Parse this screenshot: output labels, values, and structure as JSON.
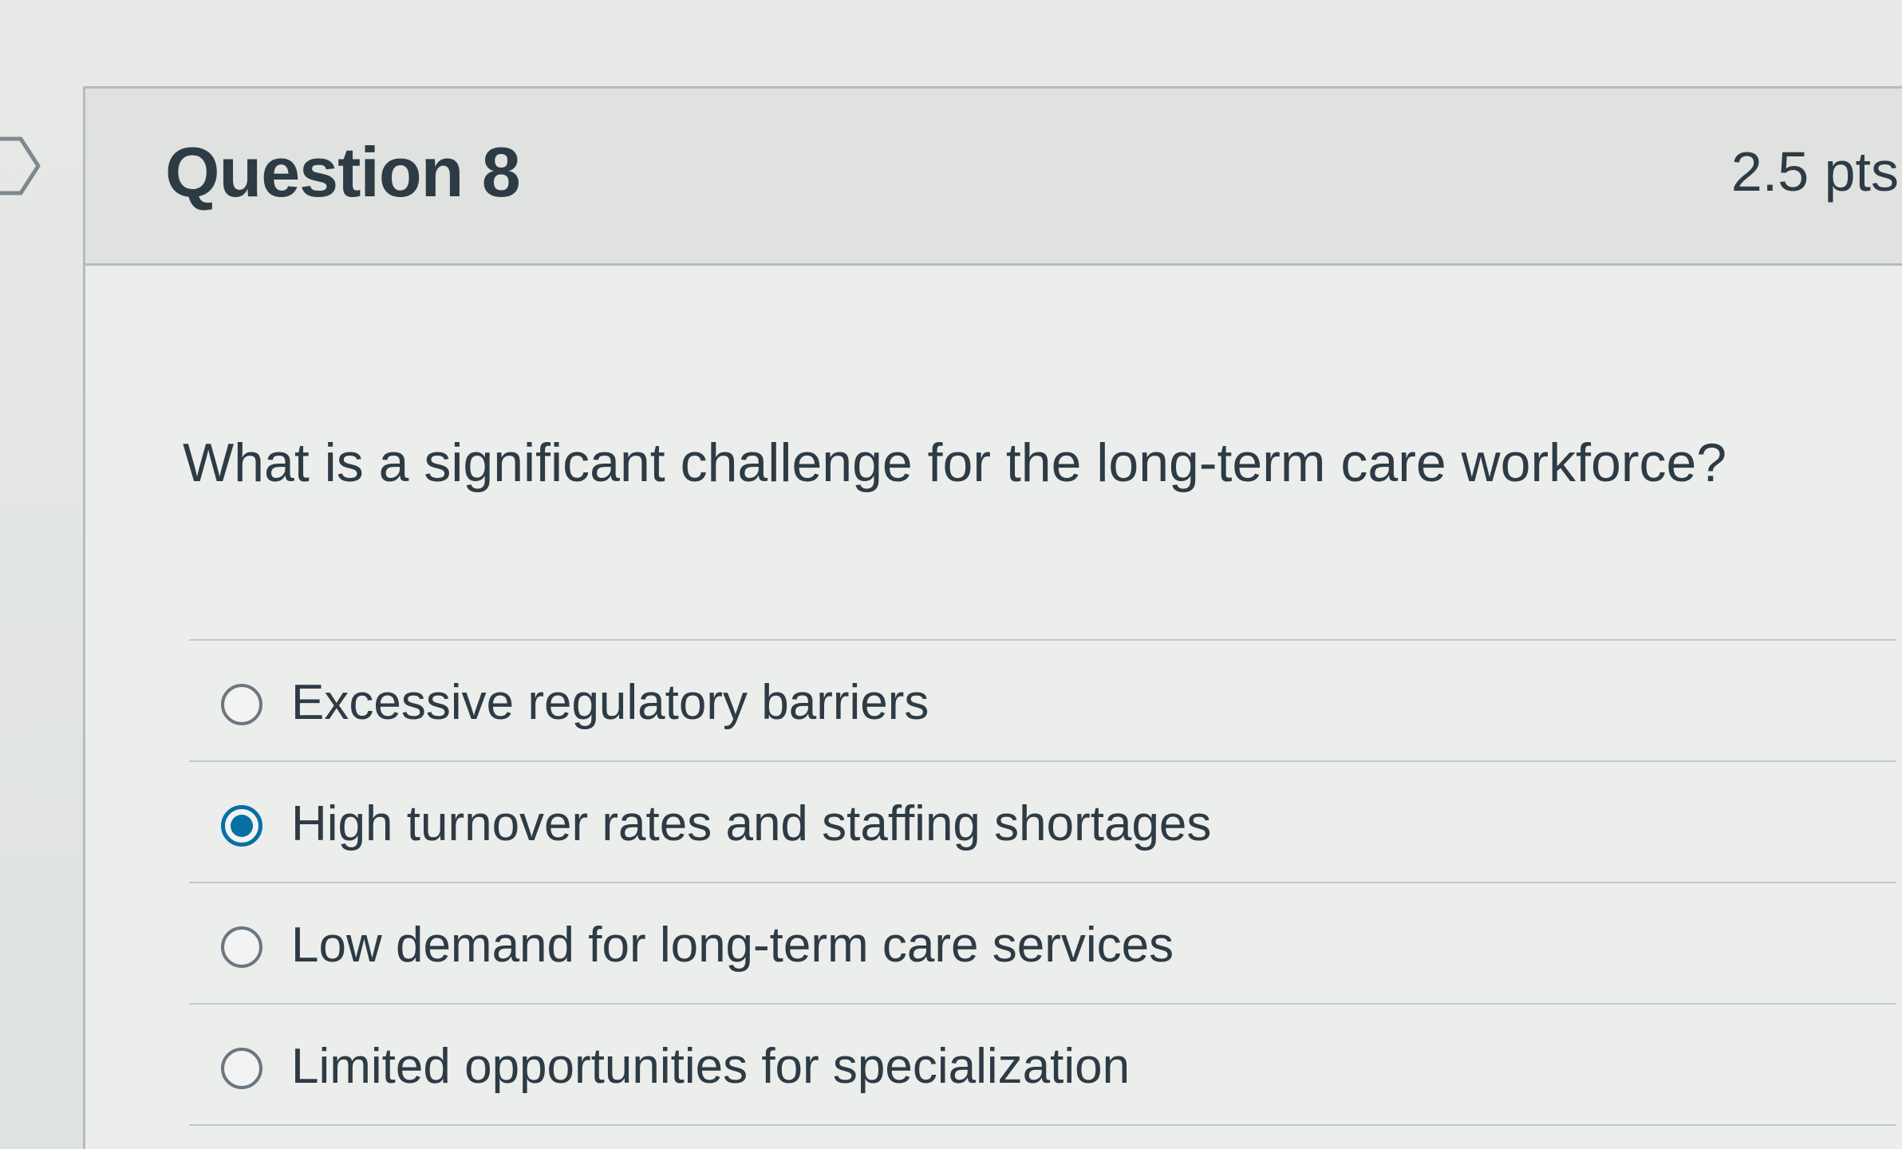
{
  "question": {
    "title": "Question 8",
    "points": "2.5 pts",
    "text": "What is a significant challenge for the long-term care workforce?"
  },
  "answers": [
    {
      "label": "Excessive regulatory barriers",
      "selected": false
    },
    {
      "label": "High turnover rates and staffing shortages",
      "selected": true
    },
    {
      "label": "Low demand for long-term care services",
      "selected": false
    },
    {
      "label": "Limited opportunities for specialization",
      "selected": false
    }
  ],
  "colors": {
    "accent": "#0770a3",
    "text": "#2d3b45",
    "border": "#b6bbbb"
  },
  "icons": {
    "flag": "flag-icon"
  }
}
